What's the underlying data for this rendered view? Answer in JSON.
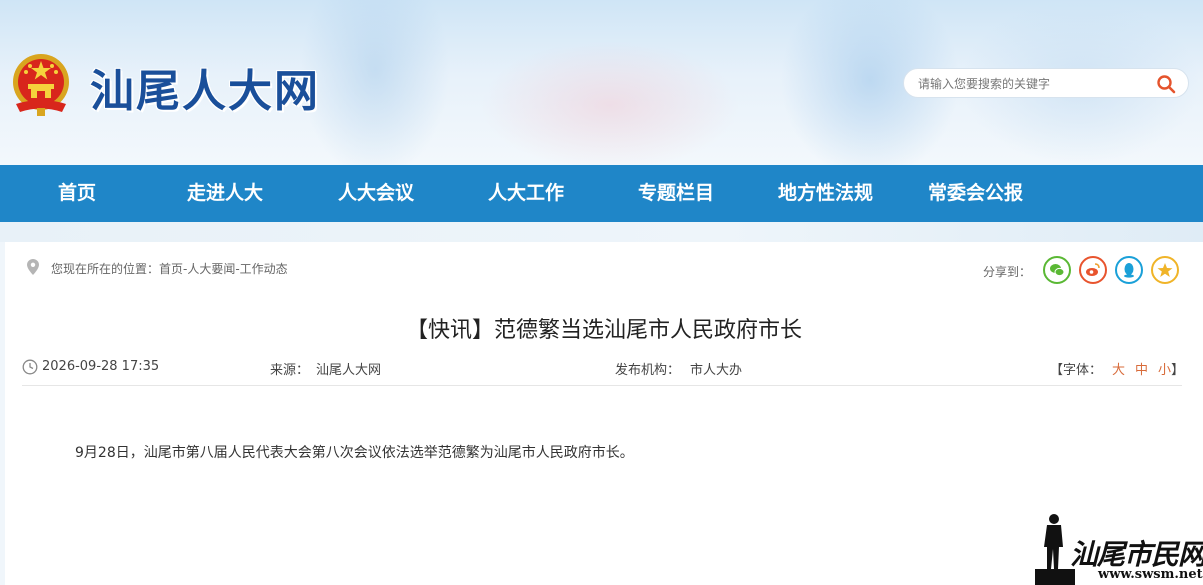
{
  "header": {
    "site_title": "汕尾人大网",
    "search_placeholder": "请输入您要搜索的关键字"
  },
  "nav": {
    "items": [
      "首页",
      "走进人大",
      "人大会议",
      "人大工作",
      "专题栏目",
      "地方性法规",
      "常委会公报"
    ]
  },
  "breadcrumb": "您现在所在的位置：首页-人大要闻-工作动态",
  "share": {
    "label": "分享到：",
    "icons": [
      "wechat-icon",
      "weibo-icon",
      "qq-icon",
      "qzone-icon"
    ],
    "colors": [
      "#5ab834",
      "#e8542e",
      "#1aa0d8",
      "#f0b428"
    ]
  },
  "article": {
    "title": "【快讯】范德繁当选汕尾市人民政府市长",
    "datetime": "2026-09-28 17:35",
    "source_label": "来源：",
    "source": "汕尾人大网",
    "publisher_label": "发布机构：",
    "publisher": "市人大办",
    "font_label": "【字体：",
    "font_large": "大",
    "font_medium": "中",
    "font_small": "小",
    "font_close": "】",
    "body": "9月28日，汕尾市第八届人民代表大会第八次会议依法选举范德繁为汕尾市人民政府市长。"
  },
  "watermark": {
    "text": "汕尾市民网",
    "url": "www.swsm.net"
  }
}
